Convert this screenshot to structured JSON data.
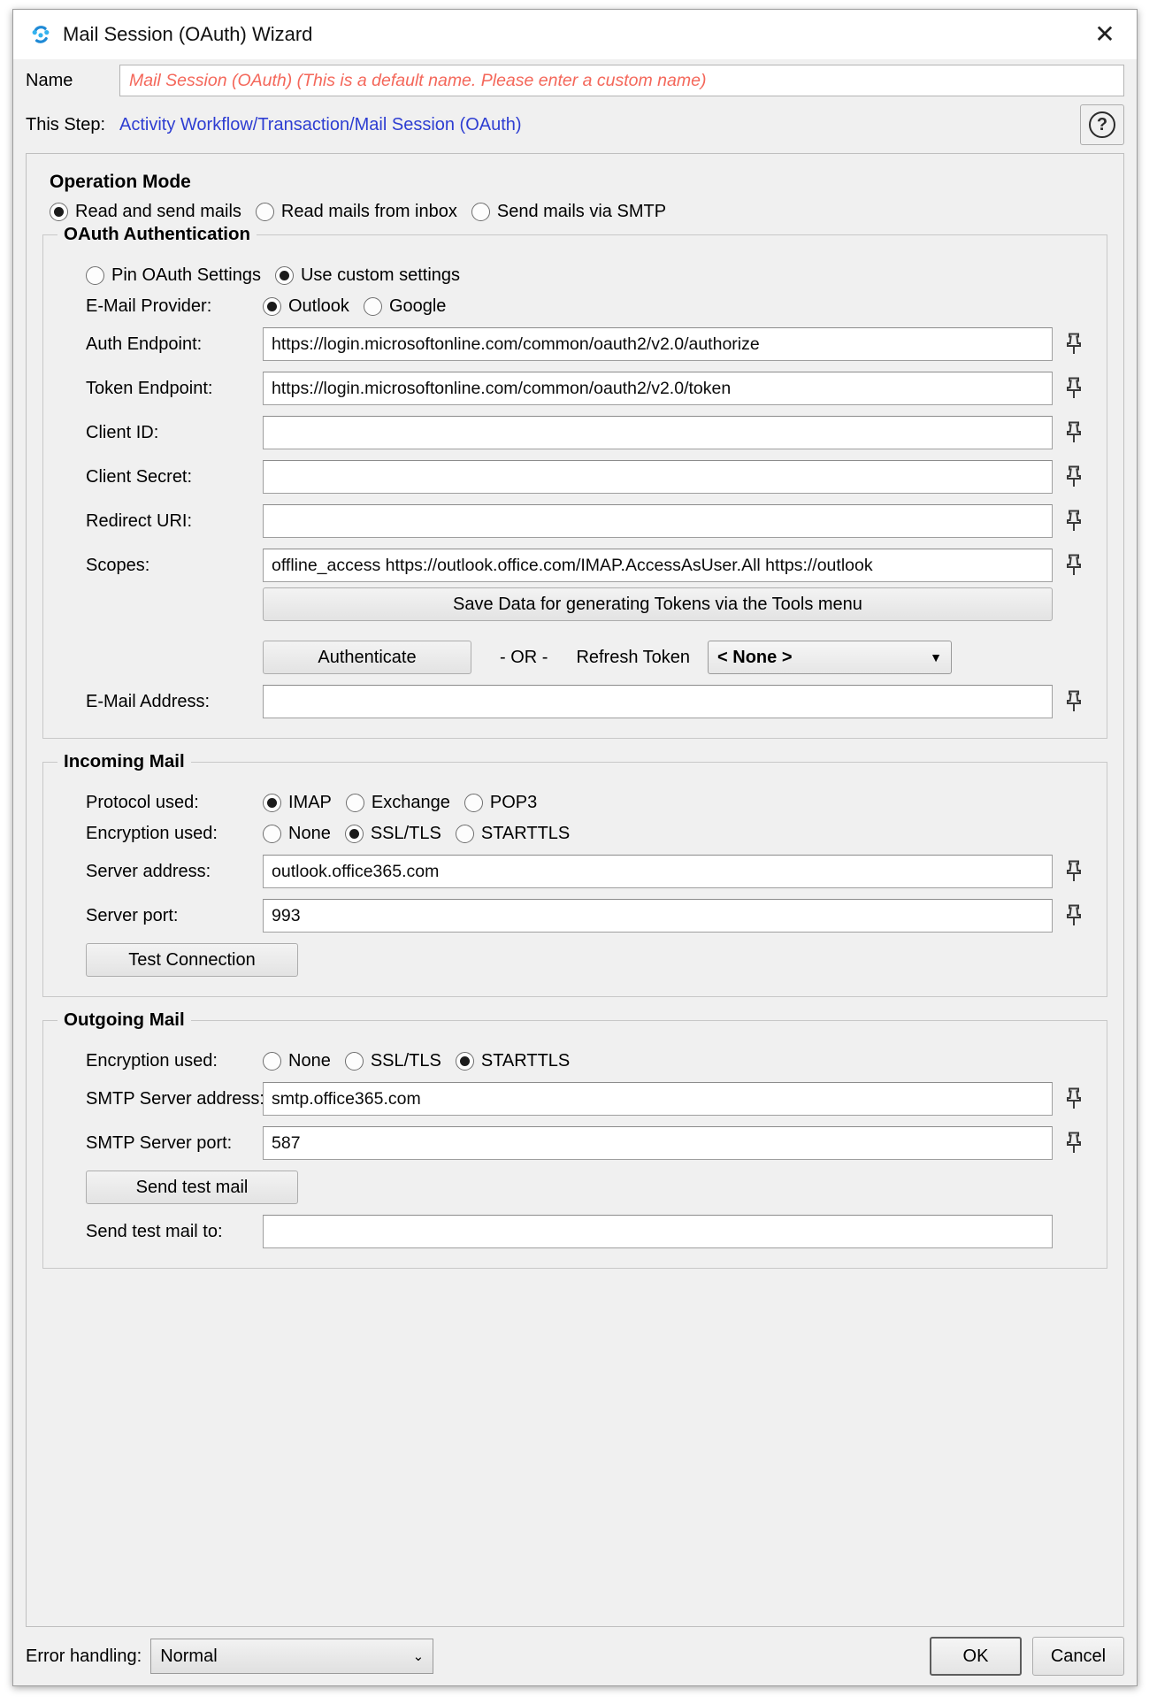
{
  "window": {
    "title": "Mail Session (OAuth) Wizard",
    "app_icon": "sync-dots-icon",
    "close_label": "✕"
  },
  "header": {
    "name_label": "Name",
    "name_value": "Mail Session (OAuth)  (This is a default name. Please enter a custom name)",
    "name_color": "#f4675a",
    "step_label": "This Step:",
    "step_value": "Activity Workflow/Transaction/Mail Session (OAuth)",
    "step_color": "#2e3ed2",
    "help_label": "?"
  },
  "operation_mode": {
    "title": "Operation Mode",
    "options": [
      {
        "label": "Read and send mails",
        "checked": true
      },
      {
        "label": "Read mails from inbox",
        "checked": false
      },
      {
        "label": "Send mails via SMTP",
        "checked": false
      }
    ]
  },
  "oauth": {
    "legend": "OAuth Authentication",
    "settings_options": [
      {
        "label": "Pin OAuth Settings",
        "checked": false
      },
      {
        "label": "Use custom settings",
        "checked": true
      }
    ],
    "provider_label": "E-Mail Provider:",
    "provider_options": [
      {
        "label": "Outlook",
        "checked": true
      },
      {
        "label": "Google",
        "checked": false
      }
    ],
    "auth_endpoint_label": "Auth Endpoint:",
    "auth_endpoint_value": "https://login.microsoftonline.com/common/oauth2/v2.0/authorize",
    "token_endpoint_label": "Token Endpoint:",
    "token_endpoint_value": "https://login.microsoftonline.com/common/oauth2/v2.0/token",
    "client_id_label": "Client ID:",
    "client_id_value": "",
    "client_secret_label": "Client Secret:",
    "client_secret_value": "",
    "redirect_uri_label": "Redirect URI:",
    "redirect_uri_value": "",
    "scopes_label": "Scopes:",
    "scopes_value": "offline_access https://outlook.office.com/IMAP.AccessAsUser.All https://outlook",
    "save_data_button": "Save Data for generating Tokens via the Tools menu",
    "authenticate_button": "Authenticate",
    "or_text": "- OR -",
    "refresh_token_label": "Refresh Token",
    "refresh_token_value": "< None >",
    "email_address_label": "E-Mail Address:",
    "email_address_value": "",
    "pin_icon": "pin-icon"
  },
  "incoming": {
    "legend": "Incoming Mail",
    "protocol_label": "Protocol used:",
    "protocol_options": [
      {
        "label": "IMAP",
        "checked": true
      },
      {
        "label": "Exchange",
        "checked": false
      },
      {
        "label": "POP3",
        "checked": false
      }
    ],
    "encryption_label": "Encryption used:",
    "encryption_options": [
      {
        "label": "None",
        "checked": false
      },
      {
        "label": "SSL/TLS",
        "checked": true
      },
      {
        "label": "STARTTLS",
        "checked": false
      }
    ],
    "server_address_label": "Server address:",
    "server_address_value": "outlook.office365.com",
    "server_port_label": "Server port:",
    "server_port_value": "993",
    "test_connection_button": "Test Connection"
  },
  "outgoing": {
    "legend": "Outgoing Mail",
    "encryption_label": "Encryption used:",
    "encryption_options": [
      {
        "label": "None",
        "checked": false
      },
      {
        "label": "SSL/TLS",
        "checked": false
      },
      {
        "label": "STARTTLS",
        "checked": true
      }
    ],
    "smtp_server_label": "SMTP Server address:",
    "smtp_server_value": "smtp.office365.com",
    "smtp_port_label": "SMTP Server port:",
    "smtp_port_value": "587",
    "send_test_mail_button": "Send test mail",
    "send_test_mail_to_label": "Send test mail to:",
    "send_test_mail_to_value": ""
  },
  "footer": {
    "error_handling_label": "Error handling:",
    "error_handling_value": "Normal",
    "ok_label": "OK",
    "cancel_label": "Cancel",
    "caret": "⌄"
  }
}
